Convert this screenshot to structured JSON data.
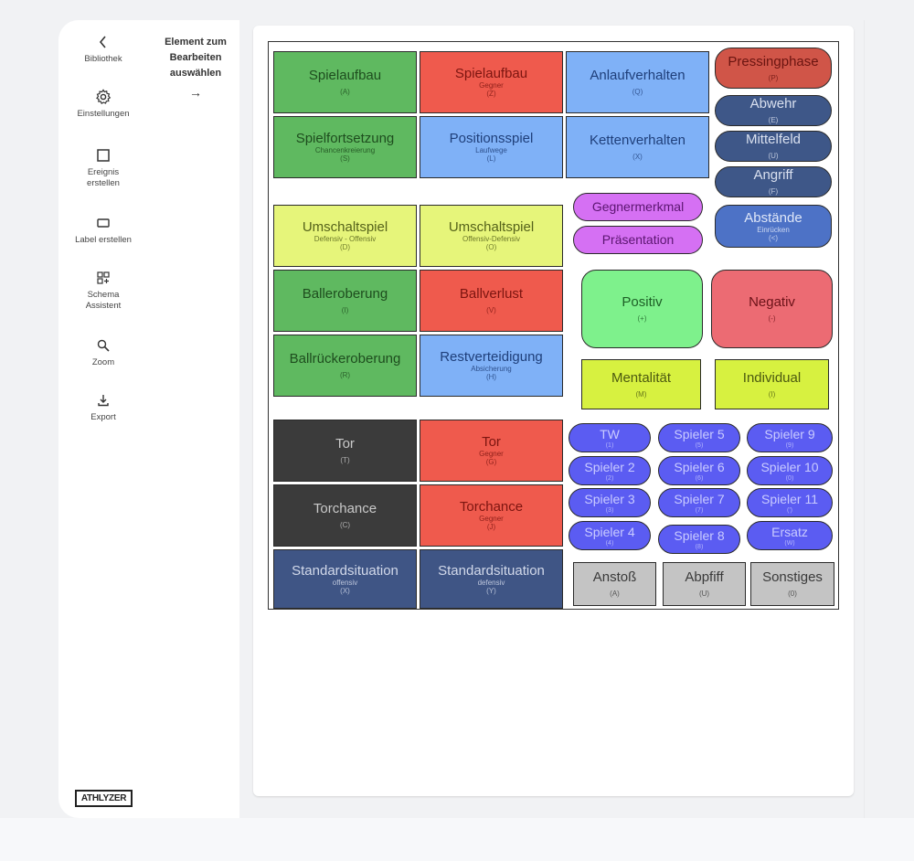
{
  "sidebar": {
    "items": [
      {
        "label": "Bibliothek",
        "icon": "chevron-left-icon"
      },
      {
        "label": "Einstellungen",
        "icon": "gear-icon"
      },
      {
        "label": "Ereignis erstellen",
        "icon": "square-icon"
      },
      {
        "label": "Label erstellen",
        "icon": "rectangle-icon"
      },
      {
        "label": "Schema Assistent",
        "icon": "grid-plus-icon"
      },
      {
        "label": "Zoom",
        "icon": "zoom-icon"
      },
      {
        "label": "Export",
        "icon": "download-icon"
      }
    ],
    "hint": "Element zum Bearbeiten auswählen",
    "hint_arrow": "→",
    "logo": "ATHLYZER"
  },
  "board": {
    "tiles": [
      {
        "title": "Spielaufbau",
        "sub": "",
        "key": "(A)",
        "color": "#5fb960"
      },
      {
        "title": "Spielaufbau",
        "sub": "Gegner",
        "key": "(Z)",
        "color": "#ef5a4d"
      },
      {
        "title": "Anlaufverhalten",
        "sub": "",
        "key": "(Q)",
        "color": "#7fb1f7"
      },
      {
        "title": "Pressingphase",
        "sub": "",
        "key": "(P)",
        "color": "#d05548"
      },
      {
        "title": "Abwehr",
        "sub": "",
        "key": "(E)",
        "color": "#3e5788"
      },
      {
        "title": "Spielfortsetzung",
        "sub": "Chancenkreierung",
        "key": "(S)",
        "color": "#5fb960"
      },
      {
        "title": "Positionsspiel",
        "sub": "Laufwege",
        "key": "(L)",
        "color": "#7fb1f7"
      },
      {
        "title": "Kettenverhalten",
        "sub": "",
        "key": "(X)",
        "color": "#7fb1f7"
      },
      {
        "title": "Mittelfeld",
        "sub": "",
        "key": "(U)",
        "color": "#3e5788"
      },
      {
        "title": "Angriff",
        "sub": "",
        "key": "(F)",
        "color": "#3e5788"
      },
      {
        "title": "Gegnermerkmal",
        "sub": "",
        "key": "",
        "color": "#d570f3"
      },
      {
        "title": "Präsentation",
        "sub": "",
        "key": "",
        "color": "#d570f3"
      },
      {
        "title": "Abstände",
        "sub": "Einrücken",
        "key": "(<)",
        "color": "#4d72c6"
      },
      {
        "title": "Umschaltspiel",
        "sub": "Defensiv - Offensiv",
        "key": "(D)",
        "color": "#e6f57a"
      },
      {
        "title": "Umschaltspiel",
        "sub": "Offensiv-Defensiv",
        "key": "(O)",
        "color": "#e6f57a"
      },
      {
        "title": "Balleroberung",
        "sub": "",
        "key": "(I)",
        "color": "#5fb960"
      },
      {
        "title": "Ballverlust",
        "sub": "",
        "key": "(V)",
        "color": "#ef5a4d"
      },
      {
        "title": "Positiv",
        "sub": "",
        "key": "(+)",
        "color": "#7ef18c"
      },
      {
        "title": "Negativ",
        "sub": "",
        "key": "(-)",
        "color": "#ec6b73"
      },
      {
        "title": "Ballrückeroberung",
        "sub": "",
        "key": "(R)",
        "color": "#5fb960"
      },
      {
        "title": "Restverteidigung",
        "sub": "Absicherung",
        "key": "(H)",
        "color": "#7fb1f7"
      },
      {
        "title": "Mentalität",
        "sub": "",
        "key": "(M)",
        "color": "#d7f140"
      },
      {
        "title": "Individual",
        "sub": "",
        "key": "(I)",
        "color": "#d7f140"
      },
      {
        "title": "Tor",
        "sub": "",
        "key": "(T)",
        "color": "#3b3b3b"
      },
      {
        "title": "Tor",
        "sub": "Gegner",
        "key": "(G)",
        "color": "#ef5a4d"
      },
      {
        "title": "Torchance",
        "sub": "",
        "key": "(C)",
        "color": "#3b3b3b"
      },
      {
        "title": "Torchance",
        "sub": "Gegner",
        "key": "(J)",
        "color": "#ef5a4d"
      },
      {
        "title": "Standardsituation",
        "sub": "offensiv",
        "key": "(X)",
        "color": "#3f5585"
      },
      {
        "title": "Standardsituation",
        "sub": "defensiv",
        "key": "(Y)",
        "color": "#3f5585"
      },
      {
        "title": "TW",
        "sub": "",
        "key": "(1)",
        "color": "#5b5cf2"
      },
      {
        "title": "Spieler 5",
        "sub": "",
        "key": "(5)",
        "color": "#5b5cf2"
      },
      {
        "title": "Spieler 9",
        "sub": "",
        "key": "(9)",
        "color": "#5b5cf2"
      },
      {
        "title": "Spieler 2",
        "sub": "",
        "key": "(2)",
        "color": "#5b5cf2"
      },
      {
        "title": "Spieler 6",
        "sub": "",
        "key": "(6)",
        "color": "#5b5cf2"
      },
      {
        "title": "Spieler 10",
        "sub": "",
        "key": "(0)",
        "color": "#5b5cf2"
      },
      {
        "title": "Spieler 3",
        "sub": "",
        "key": "(3)",
        "color": "#5b5cf2"
      },
      {
        "title": "Spieler 7",
        "sub": "",
        "key": "(7)",
        "color": "#5b5cf2"
      },
      {
        "title": "Spieler 11",
        "sub": "",
        "key": "(')",
        "color": "#5b5cf2"
      },
      {
        "title": "Spieler 4",
        "sub": "",
        "key": "(4)",
        "color": "#5b5cf2"
      },
      {
        "title": "Spieler 8",
        "sub": "",
        "key": "(8)",
        "color": "#5b5cf2"
      },
      {
        "title": "Ersatz",
        "sub": "",
        "key": "(W)",
        "color": "#5b5cf2"
      },
      {
        "title": "Anstoß",
        "sub": "",
        "key": "(A)",
        "color": "#c4c4c4"
      },
      {
        "title": "Abpfiff",
        "sub": "",
        "key": "(U)",
        "color": "#c4c4c4"
      },
      {
        "title": "Sonstiges",
        "sub": "",
        "key": "(0)",
        "color": "#c4c4c4"
      }
    ]
  }
}
